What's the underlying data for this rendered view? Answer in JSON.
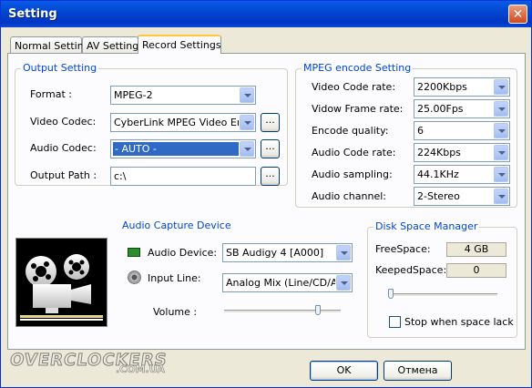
{
  "window": {
    "title": "Setting",
    "close_symbol": "✕"
  },
  "tabs": [
    {
      "label": "Normal Setting"
    },
    {
      "label": "AV Setting"
    },
    {
      "label": "Record Settings"
    }
  ],
  "output_setting": {
    "title": "Output Setting",
    "format_label": "Format :",
    "format_value": "MPEG-2",
    "video_codec_label": "Video Codec:",
    "video_codec_value": "CyberLink MPEG Video Enc",
    "audio_codec_label": "Audio Codec:",
    "audio_codec_value": "- AUTO -",
    "output_path_label": "Output Path :",
    "output_path_value": "c:\\",
    "browse_label": "..."
  },
  "mpeg_encode": {
    "title": "MPEG encode Setting",
    "rows": [
      {
        "label": "Video Code rate:",
        "value": "2200Kbps"
      },
      {
        "label": "Vidow Frame rate:",
        "value": "25.00Fps"
      },
      {
        "label": "Encode quality:",
        "value": "6"
      },
      {
        "label": "Audio Code rate:",
        "value": "224Kbps"
      },
      {
        "label": "Audio sampling:",
        "value": "44.1KHz"
      },
      {
        "label": "Audio channel:",
        "value": "2-Stereo"
      }
    ]
  },
  "audio_capture": {
    "title": "Audio Capture Device",
    "device_label": "Audio Device:",
    "device_value": "SB Audigy 4 [A000]",
    "input_label": "Input Line:",
    "input_value": "Analog Mix (Line/CD/Au",
    "volume_label": "Volume :",
    "volume_level": 0.82
  },
  "disk_space": {
    "title": "Disk Space Manager",
    "free_label": "FreeSpace:",
    "free_value": "4 GB",
    "keeped_label": "KeepedSpace:",
    "keeped_value": "0",
    "slider_level": 0.0,
    "stop_label": "Stop when space lack",
    "stop_checked": false
  },
  "buttons": {
    "ok": "OK",
    "cancel": "Отмена"
  },
  "watermark": {
    "line1": "OVERCLOCKERS",
    "line2": ".COM.UA"
  },
  "colors": {
    "title_bar": "#0A5BE8",
    "group_title": "#0046D5",
    "dialog_bg": "#ECE9D8",
    "selection": "#316AC5"
  },
  "icons": [
    "close-icon",
    "dropdown-arrow-icon",
    "sound-card-icon",
    "speaker-icon",
    "projector-icon"
  ]
}
